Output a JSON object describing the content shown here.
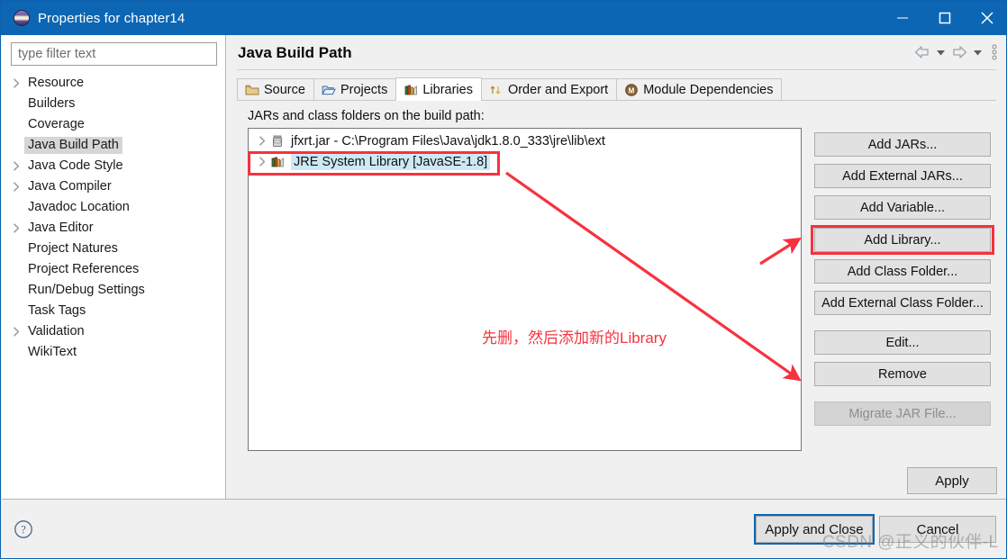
{
  "window": {
    "title": "Properties for chapter14",
    "icon": "eclipse-sphere-icon",
    "minimize_label": "Minimize",
    "maximize_label": "Maximize",
    "close_label": "Close"
  },
  "sidebar": {
    "filter": {
      "placeholder": "type filter text",
      "value": ""
    },
    "items": [
      {
        "label": "Resource",
        "expandable": true,
        "selected": false
      },
      {
        "label": "Builders",
        "expandable": false,
        "selected": false
      },
      {
        "label": "Coverage",
        "expandable": false,
        "selected": false
      },
      {
        "label": "Java Build Path",
        "expandable": false,
        "selected": true
      },
      {
        "label": "Java Code Style",
        "expandable": true,
        "selected": false
      },
      {
        "label": "Java Compiler",
        "expandable": true,
        "selected": false
      },
      {
        "label": "Javadoc Location",
        "expandable": false,
        "selected": false
      },
      {
        "label": "Java Editor",
        "expandable": true,
        "selected": false
      },
      {
        "label": "Project Natures",
        "expandable": false,
        "selected": false
      },
      {
        "label": "Project References",
        "expandable": false,
        "selected": false
      },
      {
        "label": "Run/Debug Settings",
        "expandable": false,
        "selected": false
      },
      {
        "label": "Task Tags",
        "expandable": false,
        "selected": false
      },
      {
        "label": "Validation",
        "expandable": true,
        "selected": false
      },
      {
        "label": "WikiText",
        "expandable": false,
        "selected": false
      }
    ]
  },
  "page": {
    "title": "Java Build Path",
    "nav": {
      "back_icon": "arrow-left-icon",
      "back_menu_icon": "chevron-down-icon",
      "forward_icon": "arrow-right-icon",
      "forward_menu_icon": "chevron-down-icon",
      "menu_icon": "vertical-dots-icon"
    },
    "tabs": [
      {
        "label": "Source",
        "icon": "source-folder-icon",
        "active": false
      },
      {
        "label": "Projects",
        "icon": "open-folder-icon",
        "active": false
      },
      {
        "label": "Libraries",
        "icon": "library-books-icon",
        "active": true
      },
      {
        "label": "Order and Export",
        "icon": "order-arrows-icon",
        "active": false
      },
      {
        "label": "Module Dependencies",
        "icon": "module-circle-icon",
        "active": false
      }
    ],
    "list_label": "JARs and class folders on the build path:",
    "entries": [
      {
        "label": "jfxrt.jar - C:\\Program Files\\Java\\jdk1.8.0_333\\jre\\lib\\ext",
        "icon": "jar-icon",
        "expandable": true,
        "selected": false,
        "highlighted": false
      },
      {
        "label": "JRE System Library [JavaSE-1.8]",
        "icon": "library-books-icon",
        "expandable": true,
        "selected": true,
        "highlighted": true
      }
    ],
    "buttons": [
      {
        "id": "add-jars",
        "label": "Add JARs...",
        "enabled": true,
        "highlighted": false
      },
      {
        "id": "add-external-jars",
        "label": "Add External JARs...",
        "enabled": true,
        "highlighted": false
      },
      {
        "id": "add-variable",
        "label": "Add Variable...",
        "enabled": true,
        "highlighted": false
      },
      {
        "id": "add-library",
        "label": "Add Library...",
        "enabled": true,
        "highlighted": true
      },
      {
        "id": "add-class-folder",
        "label": "Add Class Folder...",
        "enabled": true,
        "highlighted": false
      },
      {
        "id": "add-ext-class-folder",
        "label": "Add External Class Folder...",
        "enabled": true,
        "highlighted": false
      },
      {
        "id": "edit",
        "label": "Edit...",
        "enabled": true,
        "highlighted": false
      },
      {
        "id": "remove",
        "label": "Remove",
        "enabled": true,
        "highlighted": false
      },
      {
        "id": "migrate-jar-file",
        "label": "Migrate JAR File...",
        "enabled": false,
        "highlighted": false
      }
    ],
    "apply_label": "Apply"
  },
  "footer": {
    "help_icon": "help-question-icon",
    "apply_and_close_label": "Apply and Close",
    "cancel_label": "Cancel"
  },
  "annotations": {
    "note_text": "先删，然后添加新的Library",
    "accent_color": "#f5333f",
    "watermark": "CSDN @正义的伙伴-L"
  }
}
